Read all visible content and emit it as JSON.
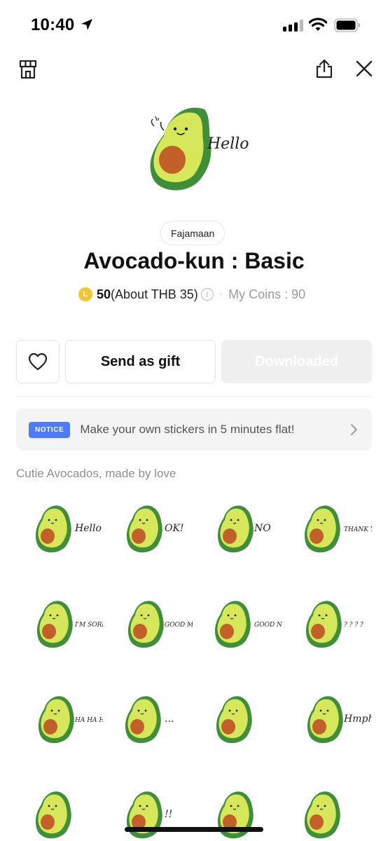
{
  "status_bar": {
    "time": "10:40"
  },
  "icons": {
    "location": "location-arrow-icon",
    "signal": "cellular-signal-icon",
    "wifi": "wifi-icon",
    "battery": "battery-icon",
    "shop": "shop-icon",
    "share": "share-icon",
    "close": "close-icon"
  },
  "hero": {
    "sticker_caption": "Hello"
  },
  "author": "Fajamaan",
  "title": "Avocado-kun : Basic",
  "price": {
    "coin_symbol": "L",
    "amount": "50",
    "approx": "(About THB 35)",
    "info_symbol": "i",
    "my_coins": "My Coins : 90"
  },
  "actions": {
    "gift_label": "Send as gift",
    "download_label": "Downloaded"
  },
  "notice": {
    "badge": "NOTICE",
    "text": "Make your own stickers in 5 minutes flat!"
  },
  "description": "Cutie Avocados, made by love",
  "stickers": [
    {
      "caption": "Hello"
    },
    {
      "caption": "OK!"
    },
    {
      "caption": "NO"
    },
    {
      "caption": "THANK YOU"
    },
    {
      "caption": "I'M SORRY..."
    },
    {
      "caption": "GOOD MORNING"
    },
    {
      "caption": "GOOD NIGHT"
    },
    {
      "caption": "? ? ? ?"
    },
    {
      "caption": "HA HA HA"
    },
    {
      "caption": "..."
    },
    {
      "caption": ""
    },
    {
      "caption": "Hmph!"
    },
    {
      "caption": ""
    },
    {
      "caption": "!!"
    },
    {
      "caption": ""
    },
    {
      "caption": ""
    }
  ],
  "colors": {
    "avocado_skin": "#3f8f3a",
    "avocado_flesh": "#d6e85a",
    "avocado_pit": "#c2602a",
    "notice_badge": "#4f7bf6",
    "coin": "#f2c531"
  }
}
